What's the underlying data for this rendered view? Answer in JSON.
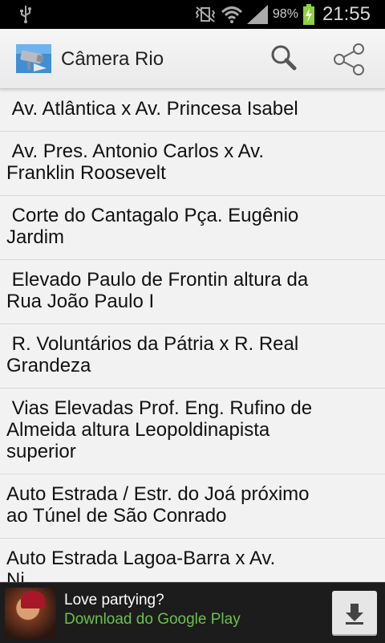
{
  "status": {
    "battery_percent": "98%",
    "time": "21:55",
    "icons": [
      "usb-icon",
      "vibrate-icon",
      "wifi-icon",
      "signal-icon",
      "battery-charging-icon"
    ]
  },
  "actionbar": {
    "title": "Câmera Rio",
    "icons": [
      "app-camera-icon",
      "search-icon",
      "share-icon"
    ]
  },
  "list": {
    "items": [
      " Av. Atlântica x Av. Princesa Isabel",
      " Av. Pres. Antonio Carlos x Av.\nFranklin Roosevelt",
      " Corte do Cantagalo Pça. Eugênio\nJardim",
      " Elevado Paulo de Frontin altura da\nRua João Paulo I",
      " R. Voluntários da Pátria x R. Real\nGrandeza",
      " Vias Elevadas Prof. Eng. Rufino de\nAlmeida altura Leopoldinapista\nsuperior",
      "Auto Estrada / Estr. do Joá próximo\nao Túnel de São Conrado",
      "Auto Estrada Lagoa-Barra x Av.\nNi..."
    ]
  },
  "ad": {
    "title": "Love partying?",
    "subtitle": "Download do Google Play",
    "icons": [
      "ad-game-thumbnail",
      "download-icon"
    ]
  },
  "colors": {
    "ad_green": "#6cc04a",
    "actionbar_bg": "#efefef",
    "list_bg": "#f2f2f2"
  }
}
